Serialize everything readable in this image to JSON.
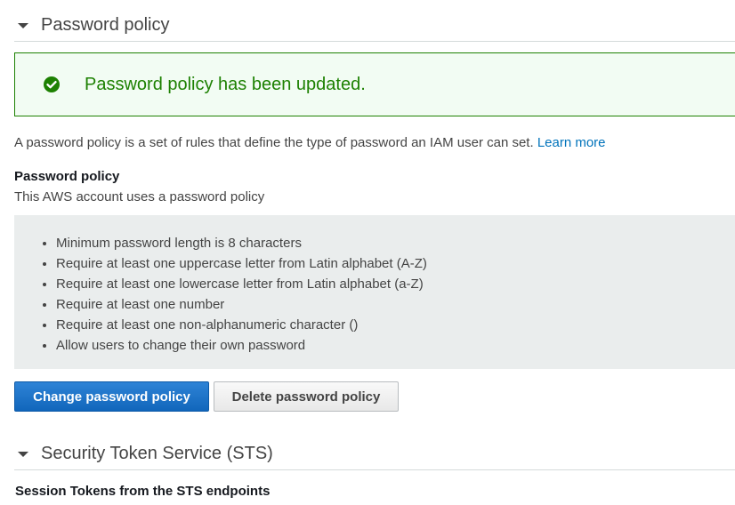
{
  "password_section": {
    "title": "Password policy"
  },
  "alert": {
    "icon": "check-circle-icon",
    "message": "Password policy has been updated.",
    "color": "#1d8102"
  },
  "description": {
    "text": "A password policy is a set of rules that define the type of password an IAM user can set.",
    "link": "Learn more"
  },
  "policy": {
    "heading": "Password policy",
    "status": "This AWS account uses a password policy",
    "rules": [
      "Minimum password length is 8 characters",
      "Require at least one uppercase letter from Latin alphabet (A-Z)",
      "Require at least one lowercase letter from Latin alphabet (a-Z)",
      "Require at least one number",
      "Require at least one non-alphanumeric character ()",
      "Allow users to change their own password"
    ]
  },
  "buttons": {
    "change": "Change password policy",
    "delete": "Delete password policy"
  },
  "sts_section": {
    "title": "Security Token Service (STS)",
    "subheading": "Session Tokens from the STS endpoints"
  }
}
